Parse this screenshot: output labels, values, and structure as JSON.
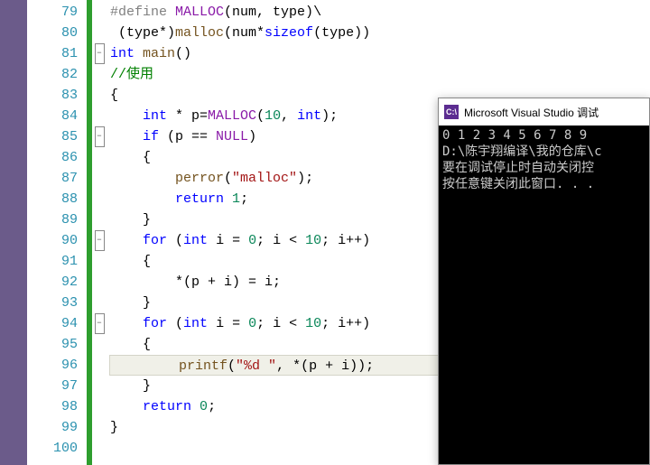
{
  "editor": {
    "line_start": 79,
    "line_end": 100,
    "fold_lines": [
      81,
      85,
      90,
      94
    ],
    "highlight_line": 96,
    "tokens": {
      "79": [
        [
          "pp",
          "#define"
        ],
        [
          "",
          " "
        ],
        [
          "mac",
          "MALLOC"
        ],
        [
          "",
          "(num, type)\\"
        ]
      ],
      "80": [
        [
          "",
          " (type*)"
        ],
        [
          "fn",
          "malloc"
        ],
        [
          "",
          "(num*"
        ],
        [
          "kw",
          "sizeof"
        ],
        [
          "",
          "(type))"
        ]
      ],
      "81": [
        [
          "kw",
          "int"
        ],
        [
          "",
          " "
        ],
        [
          "fn",
          "main"
        ],
        [
          "",
          "()"
        ]
      ],
      "82": [
        [
          "cmt",
          "//使用"
        ]
      ],
      "83": [
        [
          "",
          "{"
        ]
      ],
      "84": [
        [
          "",
          "    "
        ],
        [
          "kw",
          "int"
        ],
        [
          "",
          " * p="
        ],
        [
          "mac",
          "MALLOC"
        ],
        [
          "",
          "("
        ],
        [
          "num",
          "10"
        ],
        [
          "",
          ", "
        ],
        [
          "kw",
          "int"
        ],
        [
          "",
          ");"
        ]
      ],
      "85": [
        [
          "",
          "    "
        ],
        [
          "kw",
          "if"
        ],
        [
          "",
          " (p == "
        ],
        [
          "mac",
          "NULL"
        ],
        [
          "",
          ")"
        ]
      ],
      "86": [
        [
          "",
          "    {"
        ]
      ],
      "87": [
        [
          "",
          "        "
        ],
        [
          "fn",
          "perror"
        ],
        [
          "",
          "("
        ],
        [
          "str",
          "\"malloc\""
        ],
        [
          "",
          ");"
        ]
      ],
      "88": [
        [
          "",
          "        "
        ],
        [
          "kw",
          "return"
        ],
        [
          "",
          " "
        ],
        [
          "num",
          "1"
        ],
        [
          "",
          ";"
        ]
      ],
      "89": [
        [
          "",
          "    }"
        ]
      ],
      "90": [
        [
          "",
          "    "
        ],
        [
          "kw",
          "for"
        ],
        [
          "",
          " ("
        ],
        [
          "kw",
          "int"
        ],
        [
          "",
          " i = "
        ],
        [
          "num",
          "0"
        ],
        [
          "",
          "; i < "
        ],
        [
          "num",
          "10"
        ],
        [
          "",
          "; i++)"
        ]
      ],
      "91": [
        [
          "",
          "    {"
        ]
      ],
      "92": [
        [
          "",
          "        *(p + i) = i;"
        ]
      ],
      "93": [
        [
          "",
          "    }"
        ]
      ],
      "94": [
        [
          "",
          "    "
        ],
        [
          "kw",
          "for"
        ],
        [
          "",
          " ("
        ],
        [
          "kw",
          "int"
        ],
        [
          "",
          " i = "
        ],
        [
          "num",
          "0"
        ],
        [
          "",
          "; i < "
        ],
        [
          "num",
          "10"
        ],
        [
          "",
          "; i++)"
        ]
      ],
      "95": [
        [
          "",
          "    {"
        ]
      ],
      "96": [
        [
          "",
          "        "
        ],
        [
          "fn",
          "printf"
        ],
        [
          "",
          "("
        ],
        [
          "str",
          "\"%d \""
        ],
        [
          "",
          ", *(p + i));"
        ]
      ],
      "97": [
        [
          "",
          "    }"
        ]
      ],
      "98": [
        [
          "",
          "    "
        ],
        [
          "kw",
          "return"
        ],
        [
          "",
          " "
        ],
        [
          "num",
          "0"
        ],
        [
          "",
          ";"
        ]
      ],
      "99": [
        [
          "",
          "}"
        ]
      ],
      "100": [
        [
          "",
          ""
        ]
      ]
    }
  },
  "console": {
    "icon_text": "C:\\",
    "title": "Microsoft Visual Studio 调试",
    "lines": [
      "0 1 2 3 4 5 6 7 8 9",
      "D:\\陈宇翔编译\\我的仓库\\c",
      "要在调试停止时自动关闭控",
      "按任意键关闭此窗口. . ."
    ]
  }
}
